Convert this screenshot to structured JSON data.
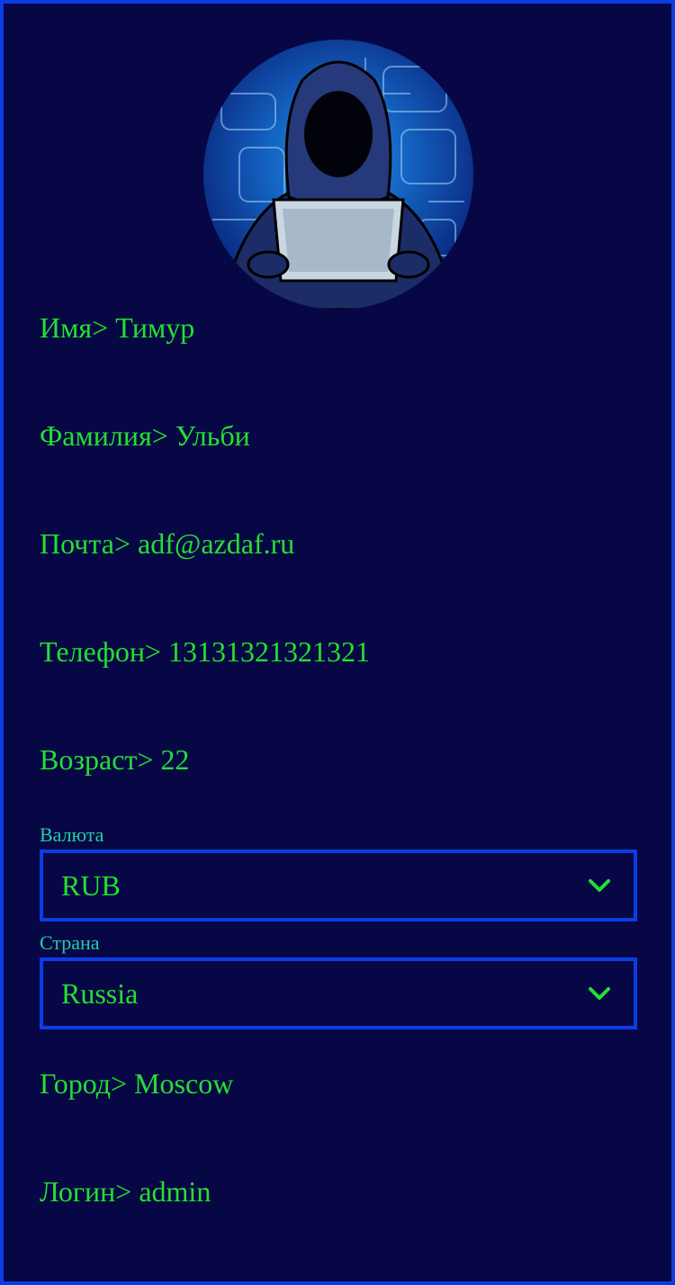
{
  "profile": {
    "name_label": "Имя> Тимур",
    "surname_label": "Фамилия> Ульби",
    "email_label": "Почта> adf@azdaf.ru",
    "phone_label": "Телефон> 13131321321321",
    "age_label": "Возраст> 22",
    "city_label": "Город> Moscow",
    "login_label": "Логин> admin"
  },
  "currency": {
    "label": "Валюта",
    "selected": "RUB"
  },
  "country": {
    "label": "Страна",
    "selected": "Russia"
  },
  "icons": {
    "avatar": "hacker-avatar-icon",
    "select_arrow": "chevron-down-icon"
  },
  "colors": {
    "background": "#070746",
    "border": "#0a3de6",
    "text": "#22e030",
    "label": "#22d0a0"
  }
}
